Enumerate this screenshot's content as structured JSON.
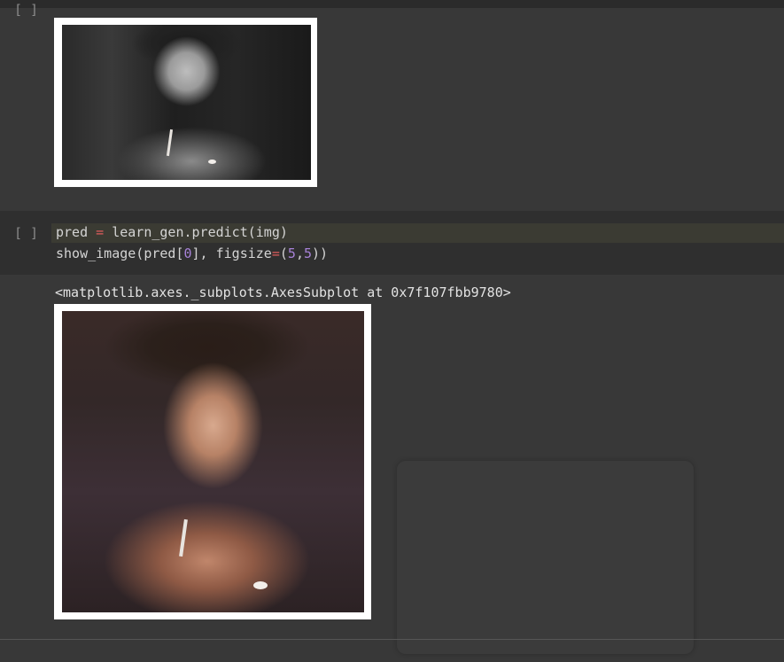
{
  "cells": [
    {
      "prompt": "[ ]",
      "output_image": {
        "kind": "black-and-white portrait photo",
        "icon": "image-bw"
      }
    },
    {
      "prompt": "[ ]",
      "code": {
        "line1": {
          "t1": "pred",
          "t2": " = ",
          "t3": "learn_gen.predict(img)"
        },
        "line2": {
          "t1": "show_image(pred[",
          "t2": "0",
          "t3": "], figsize",
          "t4": "=",
          "t5": "(",
          "t6": "5",
          "t7": ",",
          "t8": "5",
          "t9": "))"
        }
      },
      "output_text": "<matplotlib.axes._subplots.AxesSubplot at 0x7f107fbb9780>",
      "output_image": {
        "kind": "colorized portrait photo",
        "icon": "image-color"
      }
    }
  ],
  "colors": {
    "background": "#383838",
    "code_bg": "#2f2f2f",
    "operator": "#e05d5d",
    "number": "#a782d8",
    "text": "#d4d4d4"
  }
}
